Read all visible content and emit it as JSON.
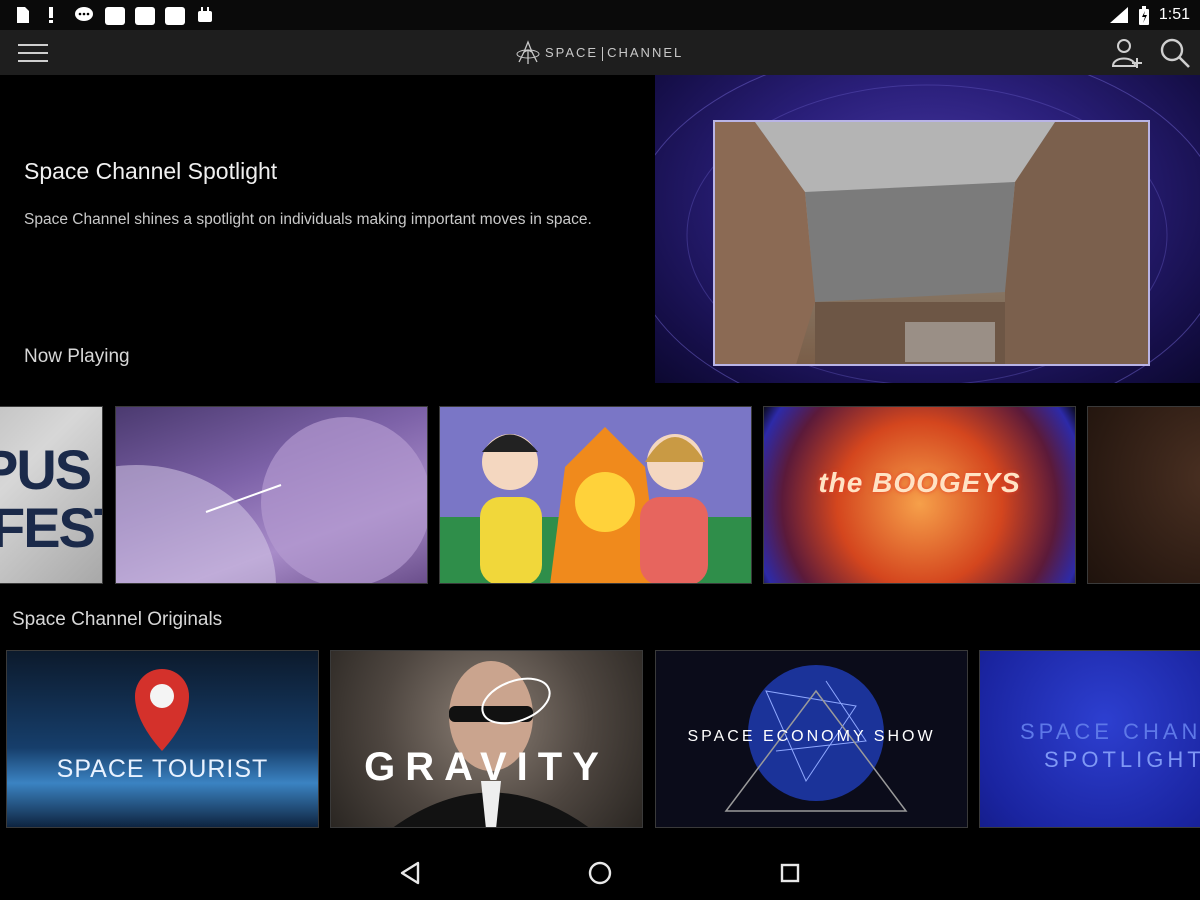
{
  "status_bar": {
    "time": "1:51"
  },
  "app_bar": {
    "logo_left": "SPACE",
    "logo_right": "CHANNEL",
    "icons": [
      "menu-icon",
      "add-user-icon",
      "search-icon"
    ]
  },
  "spotlight": {
    "title": "Space Channel Spotlight",
    "description": "Space Channel shines a spotlight on individuals making important moves in space."
  },
  "now_playing": {
    "title": "Now Playing",
    "tiles": [
      {
        "label_line1": "PUS",
        "label_line2": "FEST"
      },
      {
        "label": ""
      },
      {
        "label": ""
      },
      {
        "label": "the BOOGEYS"
      },
      {
        "label": ""
      }
    ]
  },
  "originals": {
    "title": "Space Channel Originals",
    "tiles": [
      {
        "label": "SPACE TOURIST"
      },
      {
        "label": "GRAVITY"
      },
      {
        "label": "SPACE ECONOMY SHOW"
      },
      {
        "label_line1": "SPACE CHANNEL",
        "label_line2": "SPOTLIGHT"
      }
    ]
  },
  "colors": {
    "background": "#000000",
    "app_bar": "#1e1e1e",
    "hero_purple": "#2a1f7a"
  }
}
